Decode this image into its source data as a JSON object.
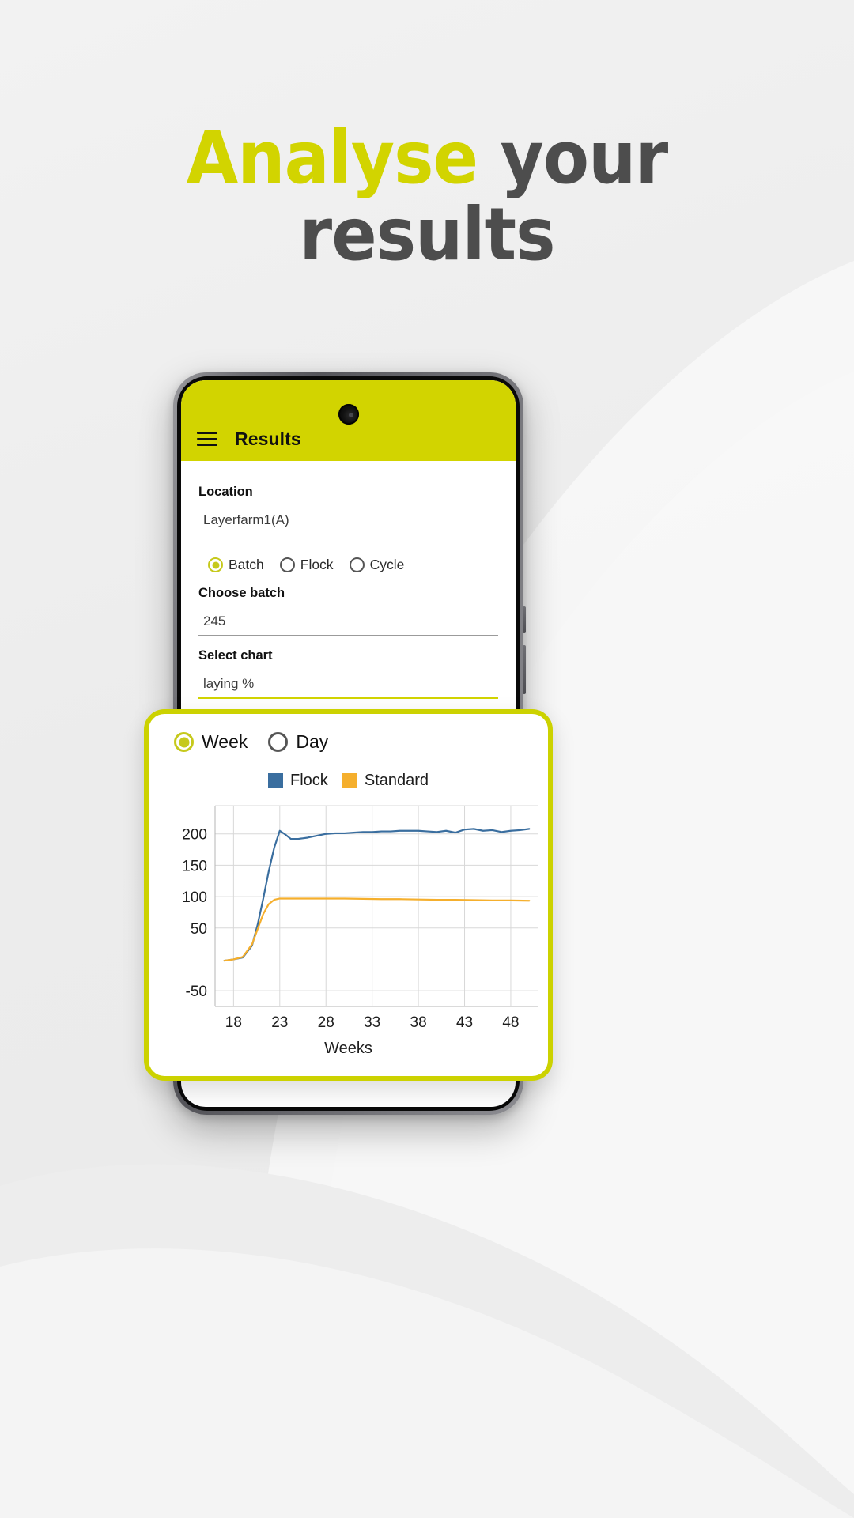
{
  "headline": {
    "line1_accent": "Analyse",
    "line1_rest": "your",
    "line2": "results",
    "accent_color": "#d2d400",
    "text_color": "#4d4d4d"
  },
  "phone": {
    "appbar": {
      "menu_icon": "hamburger-menu-icon",
      "title": "Results",
      "background_color": "#d2d400"
    },
    "form": {
      "location": {
        "label": "Location",
        "value": "Layerfarm1(A)"
      },
      "scope_radio": {
        "options": [
          "Batch",
          "Flock",
          "Cycle"
        ],
        "selected": "Batch"
      },
      "batch": {
        "label": "Choose batch",
        "value": "245"
      },
      "chart_select": {
        "label": "Select chart",
        "value": "laying %"
      },
      "period_radio_partial": {
        "options": [
          "Week",
          "Day"
        ],
        "selected": "Week"
      }
    }
  },
  "chart_card": {
    "period_radio": {
      "options": [
        "Week",
        "Day"
      ],
      "selected": "Week"
    },
    "border_color": "#ccd200"
  },
  "chart_data": {
    "type": "line",
    "title": "",
    "xlabel": "Weeks",
    "ylabel": "",
    "xticks": [
      18,
      23,
      28,
      33,
      38,
      43,
      48
    ],
    "yticks": [
      -50,
      50,
      100,
      150,
      200
    ],
    "ytick_labels": [
      "-50",
      "50",
      "100",
      "150",
      "200"
    ],
    "xlim": [
      16,
      51
    ],
    "ylim": [
      -75,
      245
    ],
    "grid": true,
    "legend_position": "top-center",
    "series": [
      {
        "name": "Flock",
        "color": "#3A6E9F",
        "x": [
          17,
          18,
          19,
          20,
          20.6,
          21.2,
          21.8,
          22.4,
          23,
          23.6,
          24.2,
          25,
          26,
          27,
          28,
          29,
          30,
          31,
          32,
          33,
          34,
          35,
          36,
          37,
          38,
          39,
          40,
          41,
          42,
          43,
          44,
          45,
          46,
          47,
          48,
          49,
          50
        ],
        "y": [
          -2,
          0,
          3,
          22,
          55,
          96,
          140,
          178,
          205,
          199,
          192,
          192,
          194,
          197,
          200,
          201,
          201,
          202,
          203,
          203,
          204,
          204,
          205,
          205,
          205,
          204,
          203,
          205,
          202,
          207,
          208,
          205,
          206,
          203,
          205,
          206,
          208
        ]
      },
      {
        "name": "Standard",
        "color": "#F5AF2D",
        "x": [
          17,
          18,
          19,
          20,
          20.6,
          21.2,
          21.8,
          22.4,
          23,
          24,
          25,
          26,
          27,
          28,
          30,
          32,
          34,
          36,
          38,
          40,
          42,
          44,
          46,
          48,
          50
        ],
        "y": [
          -2,
          0,
          4,
          24,
          48,
          72,
          88,
          95,
          97,
          97,
          97,
          97,
          97,
          97,
          97,
          96.5,
          96,
          96,
          95.5,
          95,
          95,
          94.5,
          94,
          94,
          93.5
        ]
      }
    ]
  }
}
